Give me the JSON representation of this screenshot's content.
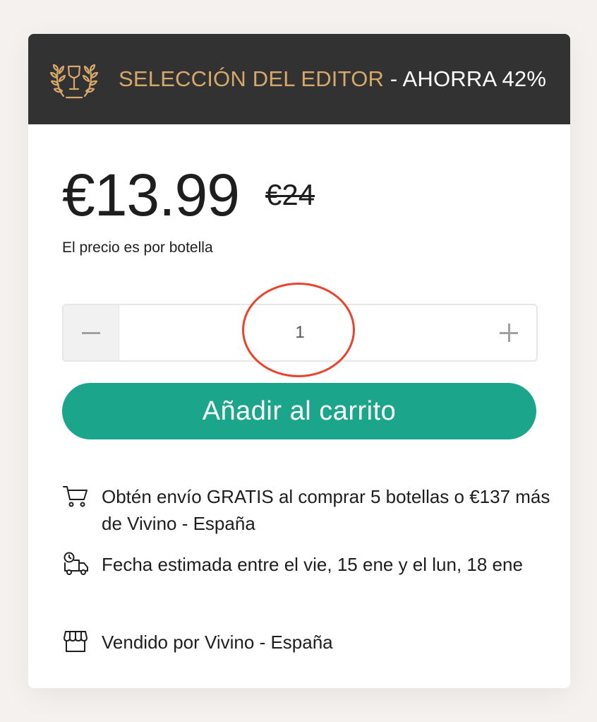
{
  "banner": {
    "label_gold": "SELECCIÓN DEL EDITOR",
    "label_white": " - AHORRA 42%",
    "icon": "laurel-wine-glass-icon"
  },
  "pricing": {
    "price": "€13.99",
    "old_price": "€24",
    "note": "El precio es por botella"
  },
  "quantity": {
    "value": "1",
    "minus_icon": "minus-icon",
    "plus_icon": "plus-icon"
  },
  "cart_button": {
    "label": "Añadir al carrito"
  },
  "info": {
    "shipping": "Obtén envío GRATIS al comprar 5 botellas o €137 más de Vivino - España",
    "delivery": "Fecha estimada entre el vie, 15 ene y el lun, 18 ene",
    "seller": "Vendido por Vivino - España"
  },
  "colors": {
    "accent": "#1ba68b",
    "banner_bg": "#323232",
    "gold": "#d6a869",
    "highlight": "#e8432d"
  }
}
